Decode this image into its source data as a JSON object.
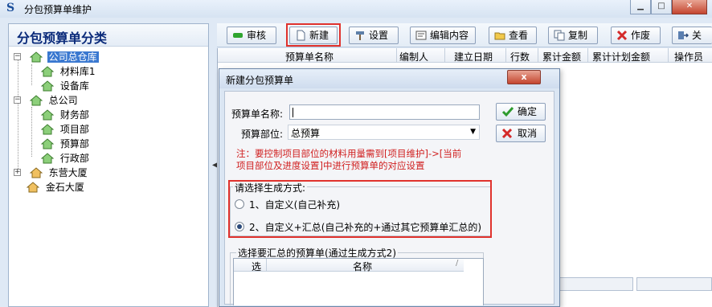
{
  "window": {
    "title": "分包预算单维护",
    "controls": [
      "minimize",
      "maximize",
      "close"
    ]
  },
  "sidebar": {
    "heading": "分包预算单分类",
    "tree": [
      {
        "label": "公司总仓库",
        "expander": "−",
        "selected": true
      },
      {
        "label": "材料库1"
      },
      {
        "label": "设备库"
      },
      {
        "label": "总公司",
        "expander": "−"
      },
      {
        "label": "财务部"
      },
      {
        "label": "项目部"
      },
      {
        "label": "预算部"
      },
      {
        "label": "行政部"
      },
      {
        "label": "东营大厦",
        "expander": "+"
      },
      {
        "label": "金石大厦"
      }
    ]
  },
  "toolbar": {
    "buttons": [
      {
        "label": "审核",
        "icon": "green-bar-icon"
      },
      {
        "label": "新建",
        "icon": "new-document-icon"
      },
      {
        "label": "设置",
        "icon": "hammer-icon"
      },
      {
        "label": "编辑内容",
        "icon": "edit-icon"
      },
      {
        "label": "查看",
        "icon": "folder-open-icon"
      },
      {
        "label": "复制",
        "icon": "copy-icon"
      },
      {
        "label": "作废",
        "icon": "red-x-icon"
      },
      {
        "label": "关",
        "icon": "exit-icon"
      }
    ]
  },
  "grid": {
    "columns": [
      "预算单名称",
      "编制人",
      "建立日期",
      "行数",
      "累计金额",
      "累计计划金额",
      "操作员"
    ]
  },
  "dialog": {
    "title": "新建分包预算单",
    "close_label": "x",
    "name_label": "预算单名称:",
    "name_value": "",
    "dept_label": "预算部位:",
    "dept_value": "总预算",
    "ok_label": "确定",
    "cancel_label": "取消",
    "note_line1": "注：要控制项目部位的材料用量需到[项目维护]->[当前",
    "note_line2": "项目部位及进度设置]中进行预算单的对应设置",
    "mode_group_title": "请选择生成方式:",
    "mode_options": [
      {
        "label": "1、自定义(自己补充)",
        "checked": false
      },
      {
        "label": "2、自定义+汇总(自己补充的+通过其它预算单汇总的)",
        "checked": true
      }
    ],
    "summary_group_title": "选择要汇总的预算单(通过生成方式2)",
    "summary_columns": [
      "选",
      "名称"
    ]
  },
  "colors": {
    "highlight": "#e0322d",
    "note_text": "#d02020",
    "selection": "#3a78d0"
  }
}
